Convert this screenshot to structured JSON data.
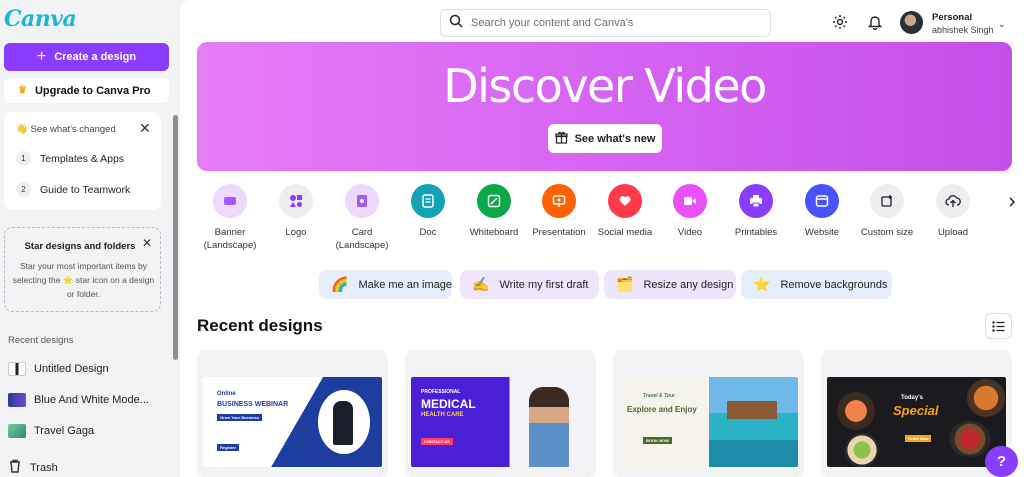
{
  "sidebar": {
    "logo": "Canva",
    "create_label": "Create a design",
    "upgrade_label": "Upgrade to Canva Pro",
    "changed": {
      "heading": "👋 See what's changed",
      "steps": [
        {
          "num": "1",
          "label": "Templates & Apps"
        },
        {
          "num": "2",
          "label": "Guide to Teamwork"
        }
      ]
    },
    "star": {
      "title": "Star designs and folders",
      "body": "Star your most important items by selecting the ⭐ star icon on a design or folder."
    },
    "recent_label": "Recent designs",
    "recent_items": [
      {
        "label": "Untitled Design"
      },
      {
        "label": "Blue And White Mode..."
      },
      {
        "label": "Travel Gaga"
      }
    ],
    "trash_label": "Trash"
  },
  "header": {
    "search_placeholder": "Search your content and Canva's",
    "account_type": "Personal",
    "account_name": "abhishek Singh"
  },
  "banner": {
    "title": "Discover Video",
    "button_label": "See what's new"
  },
  "categories": [
    {
      "label": "Banner (Landscape)",
      "color": "#ecd9fb",
      "icon": "banner-icon"
    },
    {
      "label": "Logo",
      "color": "#eceef1",
      "icon": "logo-icon"
    },
    {
      "label": "Card (Landscape)",
      "color": "#ecd9fb",
      "icon": "card-icon"
    },
    {
      "label": "Doc",
      "color": "#13a3b5",
      "icon": "doc-icon"
    },
    {
      "label": "Whiteboard",
      "color": "#0ba84a",
      "icon": "whiteboard-icon"
    },
    {
      "label": "Presentation",
      "color": "#ff6105",
      "icon": "presentation-icon"
    },
    {
      "label": "Social media",
      "color": "#ff3b4b",
      "icon": "social-media-icon"
    },
    {
      "label": "Video",
      "color": "#e950f7",
      "icon": "video-icon"
    },
    {
      "label": "Printables",
      "color": "#8b3dff",
      "icon": "printables-icon"
    },
    {
      "label": "Website",
      "color": "#4a53fa",
      "icon": "website-icon"
    },
    {
      "label": "Custom size",
      "color": "#eceef1",
      "icon": "custom-size-icon"
    },
    {
      "label": "Upload",
      "color": "#eceef1",
      "icon": "upload-icon"
    }
  ],
  "quick_actions": [
    {
      "label": "Make me an image",
      "icon": "🌈"
    },
    {
      "label": "Write my first draft",
      "icon": "✍️"
    },
    {
      "label": "Resize any design",
      "icon": "🗂️"
    },
    {
      "label": "Remove backgrounds",
      "icon": "⭐"
    }
  ],
  "recent_designs": {
    "title": "Recent designs",
    "cards": [
      {
        "line1": "Online",
        "line2": "BUSINESS WEBINAR",
        "line3": "Grow Your Business",
        "line4": "Register"
      },
      {
        "line1": "PROFESSIONAL",
        "line2": "MEDICAL",
        "line3": "HEALTH CARE",
        "line4": "CONTACT US"
      },
      {
        "line1": "Travel & Tour",
        "line2": "Explore and Enjoy",
        "line3": "",
        "line4": "BOOK NOW"
      },
      {
        "line1": "Today's",
        "line2": "Special",
        "line3": "Order Now",
        "line4": ""
      }
    ]
  },
  "help_label": "?",
  "colors": {
    "accent": "#8b3dff",
    "brand": "#18b8d9"
  }
}
